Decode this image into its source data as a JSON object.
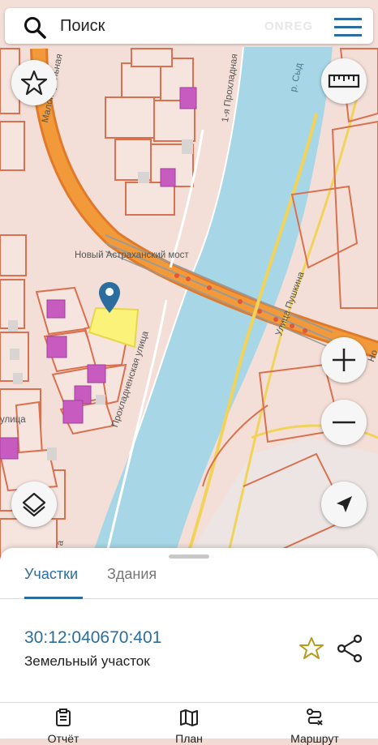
{
  "search": {
    "placeholder_text": "Поиск",
    "brand": "ONREG"
  },
  "map": {
    "labels": {
      "bridge": "Новый Астраханский мост",
      "street_malo": "Малопаральная",
      "street_proh1": "1-я Прохладная",
      "street_pushkina": "Улица Пушкина",
      "street_prohladnenskaya": "Прохладненская улица",
      "street_ulitsa": "улица",
      "street_no": "Но",
      "river": "р. Сыд",
      "a_char": "а"
    }
  },
  "panel": {
    "tabs": [
      {
        "label": "Участки",
        "active": true
      },
      {
        "label": "Здания",
        "active": false
      }
    ],
    "cadastral_number": "30:12:040670:401",
    "object_type": "Земельный участок"
  },
  "bottom_nav": [
    {
      "label": "Отчёт"
    },
    {
      "label": "План"
    },
    {
      "label": "Маршрут"
    }
  ],
  "colors": {
    "accent": "#2a6d9e",
    "river": "#a7d7e6",
    "road": "#f29a3a",
    "parcel_outline": "#d9704f",
    "selected_parcel": "#fbf27a"
  }
}
